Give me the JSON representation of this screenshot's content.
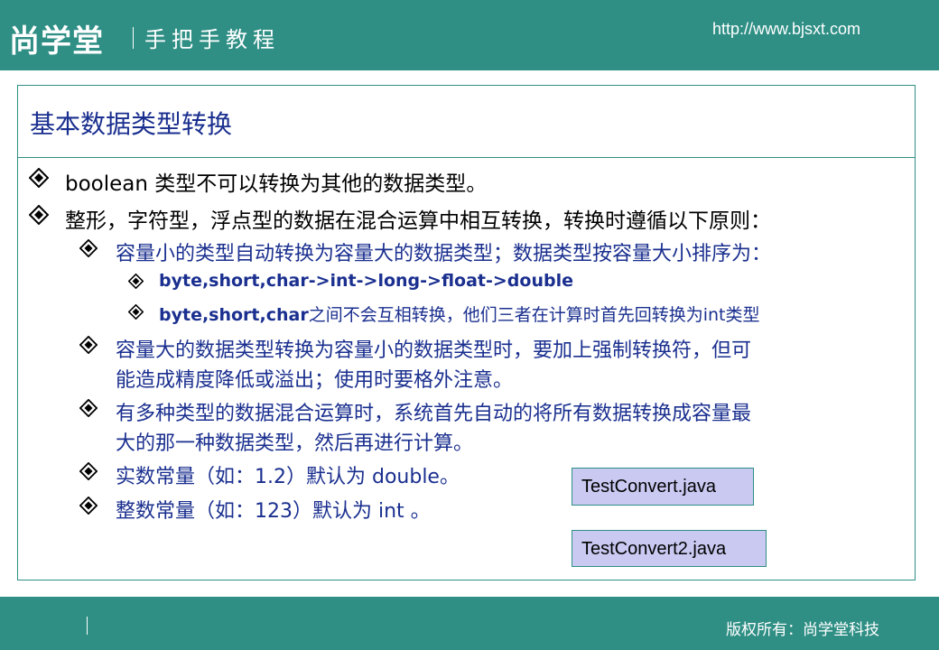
{
  "header": {
    "logo": "尚学堂",
    "tagline": "手把手教程",
    "url": "http://www.bjsxt.com"
  },
  "slide": {
    "title": "基本数据类型转换",
    "bullets": [
      {
        "level": 1,
        "text": "boolean 类型不可以转换为其他的数据类型。"
      },
      {
        "level": 1,
        "text": "整形，字符型，浮点型的数据在混合运算中相互转换，转换时遵循以下原则："
      },
      {
        "level": 2,
        "text": "容量小的类型自动转换为容量大的数据类型；数据类型按容量大小排序为："
      },
      {
        "level": 3,
        "text": "byte,short,char->int->long->float->double"
      },
      {
        "level": 3,
        "text_bold": "byte,short,char",
        "text_rest": "之间不会互相转换，他们三者在计算时首先回转换为int类型"
      },
      {
        "level": 2,
        "line1": "容量大的数据类型转换为容量小的数据类型时，要加上强制转换符，但可",
        "line2": "能造成精度降低或溢出；使用时要格外注意。"
      },
      {
        "level": 2,
        "line1": "有多种类型的数据混合运算时，系统首先自动的将所有数据转换成容量最",
        "line2": "大的那一种数据类型，然后再进行计算。"
      },
      {
        "level": 2,
        "text": "实数常量（如：1.2）默认为 double。"
      },
      {
        "level": 2,
        "text": "整数常量（如：123）默认为 int 。"
      }
    ],
    "file_buttons": [
      "TestConvert.java",
      "TestConvert2.java"
    ]
  },
  "footer": {
    "copyright": "版权所有：尚学堂科技"
  },
  "icons": {
    "bullet": "diamond-bullet-icon"
  },
  "colors": {
    "accent": "#2f8f85",
    "text_blue": "#1a2f8f",
    "button_fill": "#c9c9f2"
  }
}
